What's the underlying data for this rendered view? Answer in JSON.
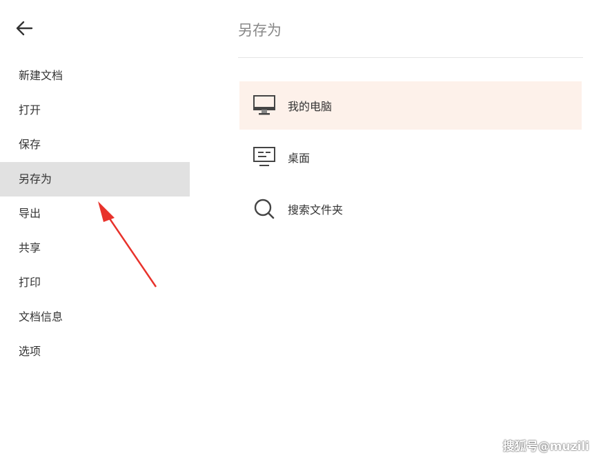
{
  "header": {
    "back_icon": "arrow-left-icon"
  },
  "sidebar": {
    "items": [
      {
        "label": "新建文档"
      },
      {
        "label": "打开"
      },
      {
        "label": "保存"
      },
      {
        "label": "另存为",
        "active": true
      },
      {
        "label": "导出"
      },
      {
        "label": "共享"
      },
      {
        "label": "打印"
      },
      {
        "label": "文档信息"
      },
      {
        "label": "选项"
      }
    ]
  },
  "main": {
    "title": "另存为",
    "locations": [
      {
        "label": "我的电脑",
        "icon": "computer-icon",
        "selected": true
      },
      {
        "label": "桌面",
        "icon": "desktop-icon"
      },
      {
        "label": "搜索文件夹",
        "icon": "search-icon"
      }
    ]
  },
  "watermark": "搜狐号@muzili",
  "colors": {
    "active_sidebar_bg": "#e1e1e1",
    "selected_location_bg": "#fdf1ea",
    "annotation_arrow": "#e8322b"
  }
}
